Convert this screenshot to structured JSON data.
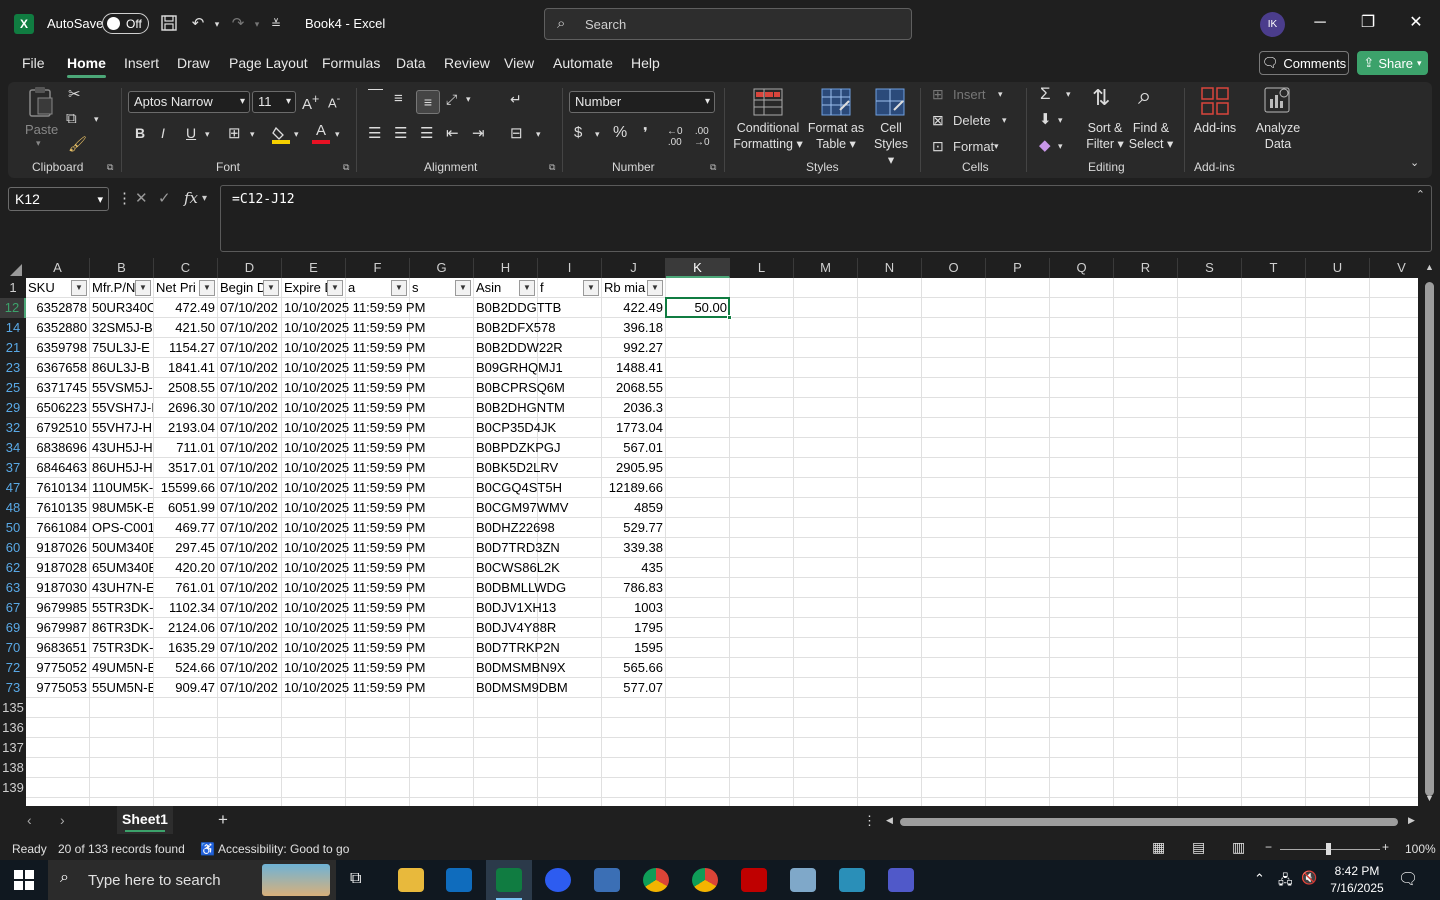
{
  "titlebar": {
    "autosave_label": "AutoSave",
    "autosave_state": "Off",
    "doc_title": "Book4 - Excel",
    "search_placeholder": "Search",
    "avatar_initials": "IK"
  },
  "menu": {
    "tabs": [
      "File",
      "Home",
      "Insert",
      "Draw",
      "Page Layout",
      "Formulas",
      "Data",
      "Review",
      "View",
      "Automate",
      "Help"
    ],
    "active": "Home",
    "comments_label": "Comments",
    "share_label": "Share"
  },
  "ribbon": {
    "clipboard": {
      "label": "Clipboard",
      "paste": "Paste"
    },
    "font": {
      "label": "Font",
      "family": "Aptos Narrow",
      "size": "11"
    },
    "alignment": {
      "label": "Alignment"
    },
    "number": {
      "label": "Number",
      "format": "Number"
    },
    "styles": {
      "label": "Styles",
      "conditional_1": "Conditional",
      "conditional_2": "Formatting",
      "format_table_1": "Format as",
      "format_table_2": "Table",
      "cell_styles_1": "Cell",
      "cell_styles_2": "Styles"
    },
    "cells": {
      "label": "Cells",
      "insert": "Insert",
      "delete": "Delete",
      "format": "Format"
    },
    "editing": {
      "label": "Editing",
      "sort_1": "Sort &",
      "sort_2": "Filter",
      "find_1": "Find &",
      "find_2": "Select"
    },
    "addins": {
      "label": "Add-ins",
      "addins_btn": "Add-ins",
      "analyze_1": "Analyze",
      "analyze_2": "Data"
    }
  },
  "formula_bar": {
    "name_box": "K12",
    "fx": "fx",
    "formula": "=C12-J12"
  },
  "grid": {
    "columns": [
      "A",
      "B",
      "C",
      "D",
      "E",
      "F",
      "G",
      "H",
      "I",
      "J",
      "K",
      "L",
      "M",
      "N",
      "O",
      "P",
      "Q",
      "R",
      "S",
      "T",
      "U",
      "V"
    ],
    "selected_column": "K",
    "headers": [
      "SKU",
      "Mfr.P/N",
      "Net Pri",
      "Begin D",
      "Expire D",
      "a",
      "s",
      "Asin",
      "f",
      "Rb mia"
    ],
    "row_numbers": [
      "1",
      "12",
      "14",
      "21",
      "23",
      "25",
      "29",
      "32",
      "34",
      "37",
      "47",
      "48",
      "50",
      "60",
      "62",
      "63",
      "67",
      "69",
      "70",
      "72",
      "73",
      "135",
      "136",
      "137",
      "138",
      "139"
    ],
    "selected_row": "12",
    "rows": [
      [
        "6352878",
        "50UR340C",
        "472.49",
        "07/10/202",
        "10/10/2025 11:59:59 PM",
        "B0B2DDGTTB",
        "422.49"
      ],
      [
        "6352880",
        "32SM5J-B",
        "421.50",
        "07/10/202",
        "10/10/2025 11:59:59 PM",
        "B0B2DFX578",
        "396.18"
      ],
      [
        "6359798",
        "75UL3J-E",
        "1154.27",
        "07/10/202",
        "10/10/2025 11:59:59 PM",
        "B0B2DDW22R",
        "992.27"
      ],
      [
        "6367658",
        "86UL3J-B",
        "1841.41",
        "07/10/202",
        "10/10/2025 11:59:59 PM",
        "B09GRHQMJ1",
        "1488.41"
      ],
      [
        "6371745",
        "55VSM5J-I",
        "2508.55",
        "07/10/202",
        "10/10/2025 11:59:59 PM",
        "B0BCPRSQ6M",
        "2068.55"
      ],
      [
        "6506223",
        "55VSH7J-I",
        "2696.30",
        "07/10/202",
        "10/10/2025 11:59:59 PM",
        "B0B2DHGNTM",
        "2036.3"
      ],
      [
        "6792510",
        "55VH7J-H",
        "2193.04",
        "07/10/202",
        "10/10/2025 11:59:59 PM",
        "B0CP35D4JK",
        "1773.04"
      ],
      [
        "6838696",
        "43UH5J-H",
        "711.01",
        "07/10/202",
        "10/10/2025 11:59:59 PM",
        "B0BPDZKPGJ",
        "567.01"
      ],
      [
        "6846463",
        "86UH5J-H",
        "3517.01",
        "07/10/202",
        "10/10/2025 11:59:59 PM",
        "B0BK5D2LRV",
        "2905.95"
      ],
      [
        "7610134",
        "110UM5K-",
        "15599.66",
        "07/10/202",
        "10/10/2025 11:59:59 PM",
        "B0CGQ4ST5H",
        "12189.66"
      ],
      [
        "7610135",
        "98UM5K-B",
        "6051.99",
        "07/10/202",
        "10/10/2025 11:59:59 PM",
        "B0CGM97WMV",
        "4859"
      ],
      [
        "7661084",
        "OPS-C001",
        "469.77",
        "07/10/202",
        "10/10/2025 11:59:59 PM",
        "B0DHZ22698",
        "529.77"
      ],
      [
        "9187026",
        "50UM340E",
        "297.45",
        "07/10/202",
        "10/10/2025 11:59:59 PM",
        "B0D7TRD3ZN",
        "339.38"
      ],
      [
        "9187028",
        "65UM340E",
        "420.20",
        "07/10/202",
        "10/10/2025 11:59:59 PM",
        "B0CWS86L2K",
        "435"
      ],
      [
        "9187030",
        "43UH7N-E",
        "761.01",
        "07/10/202",
        "10/10/2025 11:59:59 PM",
        "B0DBMLLWDG",
        "786.83"
      ],
      [
        "9679985",
        "55TR3DK-I",
        "1102.34",
        "07/10/202",
        "10/10/2025 11:59:59 PM",
        "B0DJV1XH13",
        "1003"
      ],
      [
        "9679987",
        "86TR3DK-I",
        "2124.06",
        "07/10/202",
        "10/10/2025 11:59:59 PM",
        "B0DJV4Y88R",
        "1795"
      ],
      [
        "9683651",
        "75TR3DK-I",
        "1635.29",
        "07/10/202",
        "10/10/2025 11:59:59 PM",
        "B0D7TRKP2N",
        "1595"
      ],
      [
        "9775052",
        "49UM5N-E",
        "524.66",
        "07/10/202",
        "10/10/2025 11:59:59 PM",
        "B0DMSMBN9X",
        "565.66"
      ],
      [
        "9775053",
        "55UM5N-E",
        "909.47",
        "07/10/202",
        "10/10/2025 11:59:59 PM",
        "B0DMSM9DBM",
        "577.07"
      ]
    ],
    "active_value": "50.00"
  },
  "sheets": {
    "tabs": [
      "Sheet1"
    ],
    "add_label": "+"
  },
  "status": {
    "ready": "Ready",
    "records": "20 of 133 records found",
    "accessibility": "Accessibility: Good to go",
    "zoom": "100%"
  },
  "taskbar": {
    "search_placeholder": "Type here to search",
    "time": "8:42 PM",
    "date": "7/16/2025"
  },
  "colors": {
    "accent": "#107c41",
    "share": "#3ca26b",
    "row_filtered": "#5aa9e6"
  }
}
